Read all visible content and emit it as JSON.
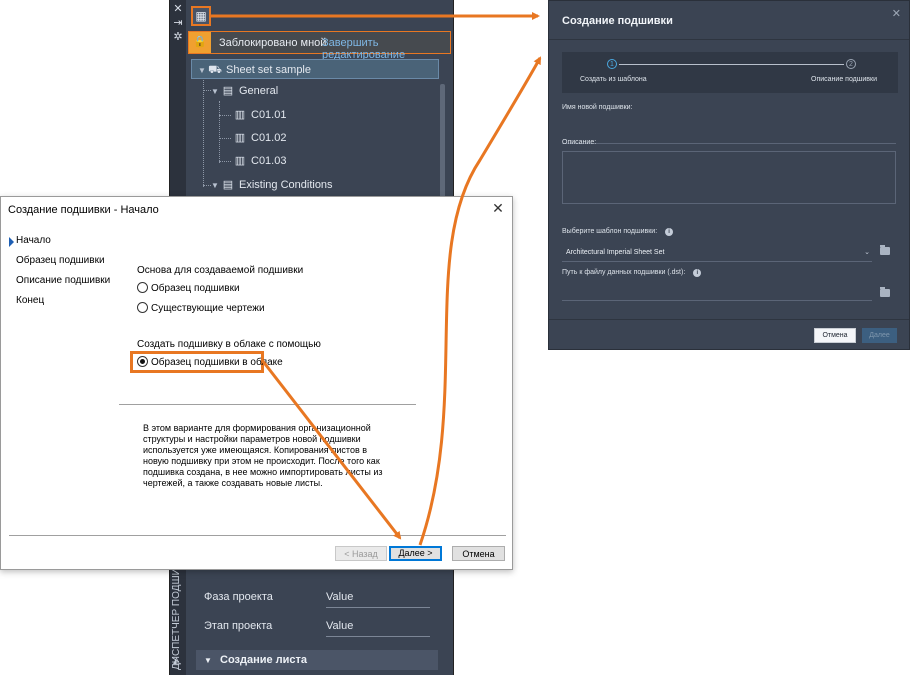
{
  "colors": {
    "accent_orange": "#e87722",
    "dark_panel": "#3b4453",
    "link_blue": "#7fb8e6",
    "win_default_border": "#0078d7"
  },
  "ssm": {
    "vertical_label": "ДИСПЕТЧЕР ПОДШИВОК",
    "locked_text": "Заблокировано мной",
    "finish_edit_link": "Завершить редактирование",
    "tree": {
      "root": "Sheet set sample",
      "subset_general": "General",
      "sheet_1": "C01.01",
      "sheet_2": "C01.02",
      "sheet_3": "C01.03",
      "subset_existing": "Existing Conditions"
    },
    "props": {
      "phase_label": "Фаза проекта",
      "phase_value": "Value",
      "stage_label": "Этап проекта",
      "stage_value": "Value",
      "section_title": "Создание листа"
    }
  },
  "win_dialog": {
    "title": "Создание подшивки - Начало",
    "close_glyph": "✕",
    "steps": [
      "Начало",
      "Образец подшивки",
      "Описание подшивки",
      "Конец"
    ],
    "basis_heading": "Основа для создаваемой подшивки",
    "option_sample": "Образец подшивки",
    "option_existing": "Существующие чертежи",
    "cloud_heading": "Создать подшивку в облаке с помощью",
    "option_cloud": "Образец подшивки в облаке",
    "description": "В этом варианте для формирования организационной структуры и настройки параметров новой подшивки используется уже имеющаяся. Копирования листов в новую подшивку при этом не происходит. После того как подшивка создана, в нее можно импортировать листы из чертежей, а также создавать новые листы.",
    "back_button": "< Назад",
    "next_button": "Далее >",
    "cancel_button": "Отмена"
  },
  "modern_dialog": {
    "title": "Создание подшивки",
    "close_glyph": "✕",
    "step1_number": "1",
    "step1_label": "Создать из шаблона",
    "step2_number": "2",
    "step2_label": "Описание подшивки",
    "name_label": "Имя новой подшивки:",
    "description_label": "Описание:",
    "template_label": "Выберите шаблон подшивки:",
    "template_value": "Architectural Imperial Sheet Set",
    "path_label": "Путь к файлу данных подшивки (.dst):",
    "cancel_button": "Отмена",
    "next_button": "Далее"
  }
}
